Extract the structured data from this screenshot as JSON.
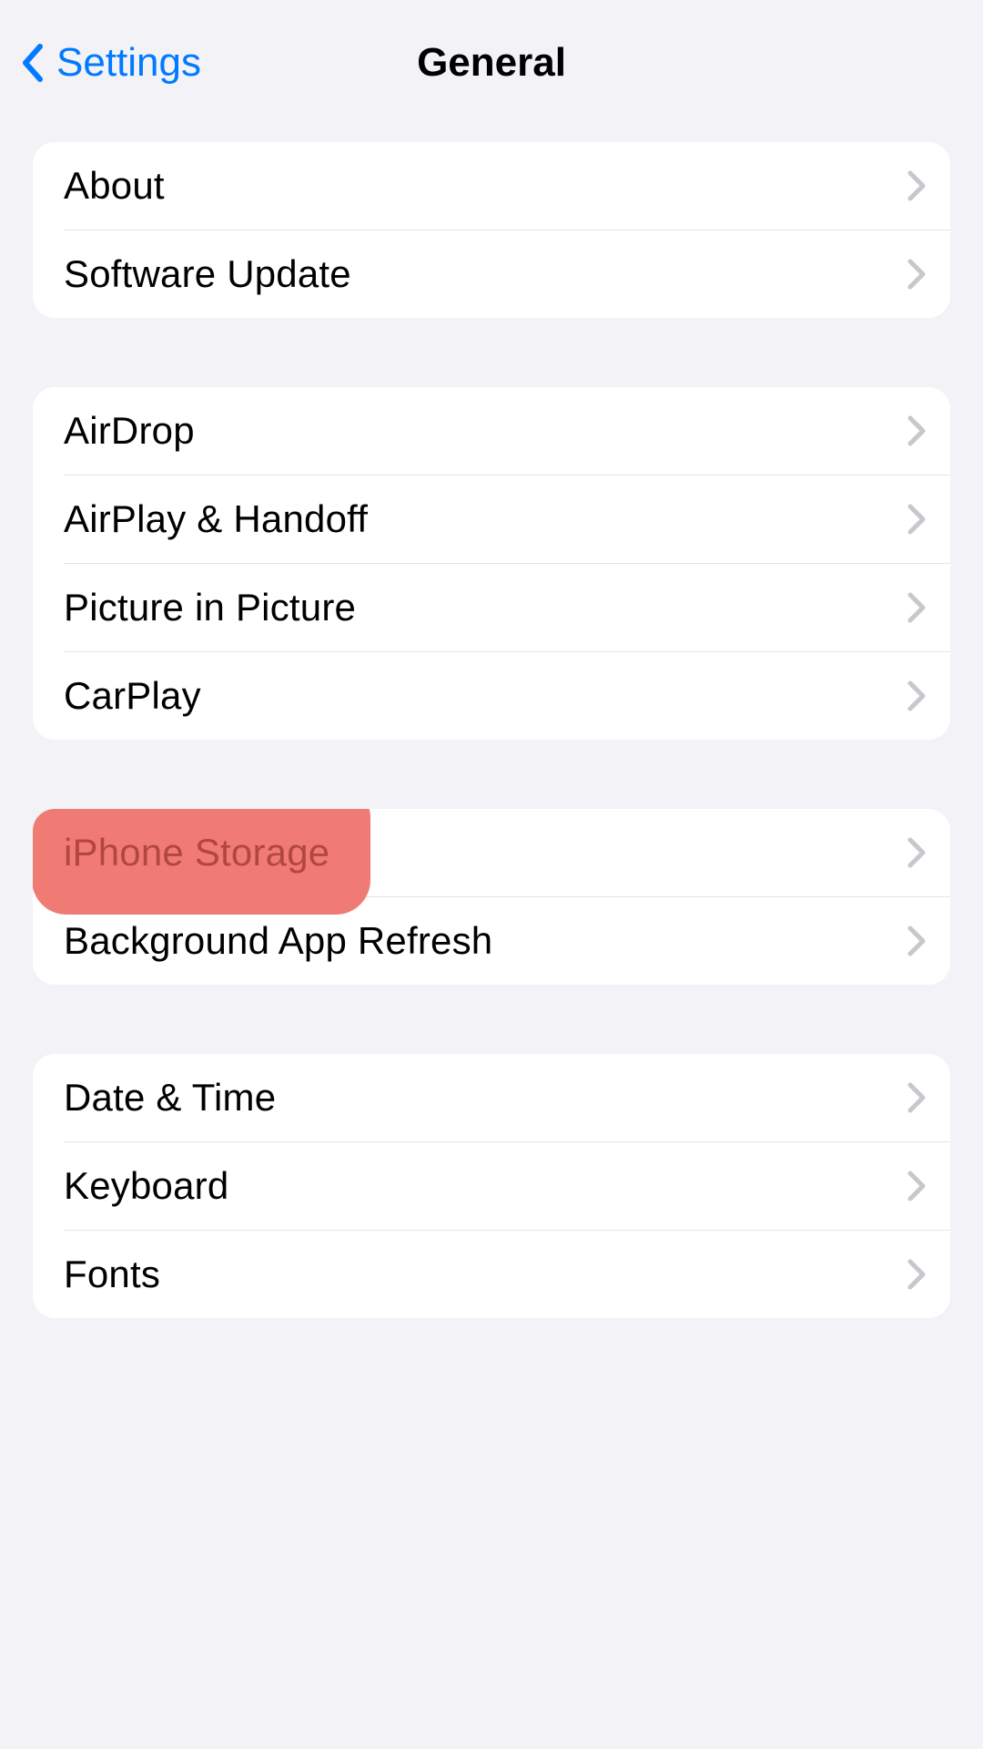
{
  "nav": {
    "back_label": "Settings",
    "title": "General"
  },
  "groups": [
    {
      "rows": [
        {
          "label": "About",
          "name": "row-about"
        },
        {
          "label": "Software Update",
          "name": "row-software-update"
        }
      ]
    },
    {
      "rows": [
        {
          "label": "AirDrop",
          "name": "row-airdrop"
        },
        {
          "label": "AirPlay & Handoff",
          "name": "row-airplay-handoff"
        },
        {
          "label": "Picture in Picture",
          "name": "row-picture-in-picture"
        },
        {
          "label": "CarPlay",
          "name": "row-carplay"
        }
      ]
    },
    {
      "rows": [
        {
          "label": "iPhone Storage",
          "name": "row-iphone-storage",
          "highlighted": true
        },
        {
          "label": "Background App Refresh",
          "name": "row-background-app-refresh"
        }
      ]
    },
    {
      "rows": [
        {
          "label": "Date & Time",
          "name": "row-date-time"
        },
        {
          "label": "Keyboard",
          "name": "row-keyboard"
        },
        {
          "label": "Fonts",
          "name": "row-fonts"
        }
      ]
    }
  ],
  "colors": {
    "accent": "#007aff",
    "highlight": "#f07b75"
  }
}
